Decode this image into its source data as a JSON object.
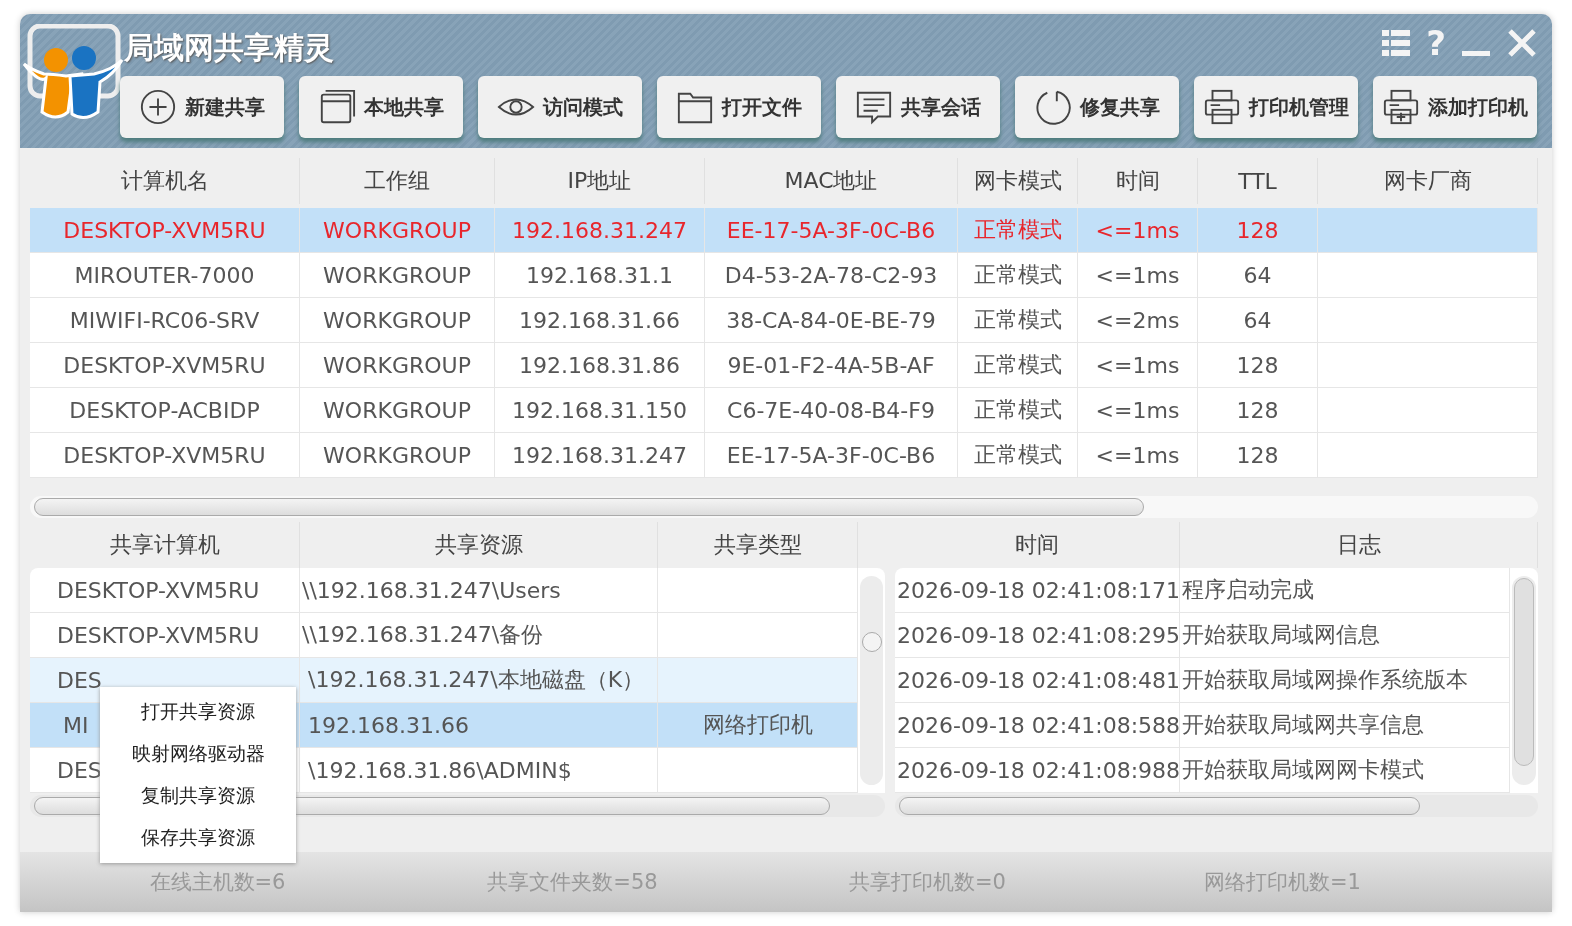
{
  "window": {
    "title": "局域网共享精灵",
    "controls": {
      "help": "?"
    }
  },
  "toolbar": [
    {
      "label": "新建共享",
      "kind": "plus"
    },
    {
      "label": "本地共享",
      "kind": "window"
    },
    {
      "label": "访问模式",
      "kind": "eye"
    },
    {
      "label": "打开文件",
      "kind": "folder"
    },
    {
      "label": "共享会话",
      "kind": "chat"
    },
    {
      "label": "修复共享",
      "kind": "refresh"
    },
    {
      "label": "打印机管理",
      "kind": "printer"
    },
    {
      "label": "添加打印机",
      "kind": "printer-add"
    }
  ],
  "hosts": {
    "columns": [
      "计算机名",
      "工作组",
      "IP地址",
      "MAC地址",
      "网卡模式",
      "时间",
      "TTL",
      "网卡厂商"
    ],
    "rows": [
      {
        "cells": [
          "DESKTOP-XVM5RU",
          "WORKGROUP",
          "192.168.31.247",
          "EE-17-5A-3F-0C-B6",
          "正常模式",
          "<=1ms",
          "128"
        ],
        "selected": true
      },
      {
        "cells": [
          "MIROUTER-7000",
          "WORKGROUP",
          "192.168.31.1",
          "D4-53-2A-78-C2-93",
          "正常模式",
          "<=1ms",
          "64"
        ],
        "selected": false
      },
      {
        "cells": [
          "MIWIFI-RC06-SRV",
          "WORKGROUP",
          "192.168.31.66",
          "38-CA-84-0E-BE-79",
          "正常模式",
          "<=2ms",
          "64"
        ],
        "selected": false
      },
      {
        "cells": [
          "DESKTOP-XVM5RU",
          "WORKGROUP",
          "192.168.31.86",
          "9E-01-F2-4A-5B-AF",
          "正常模式",
          "<=1ms",
          "128"
        ],
        "selected": false
      },
      {
        "cells": [
          "DESKTOP-ACBIDP",
          "WORKGROUP",
          "192.168.31.150",
          "C6-7E-40-08-B4-F9",
          "正常模式",
          "<=1ms",
          "128"
        ],
        "selected": false
      },
      {
        "cells": [
          "DESKTOP-XVM5RU",
          "WORKGROUP",
          "192.168.31.247",
          "EE-17-5A-3F-0C-B6",
          "正常模式",
          "<=1ms",
          "128"
        ],
        "selected": false
      }
    ]
  },
  "shares": {
    "columns": [
      "共享计算机",
      "共享资源",
      "共享类型"
    ],
    "rows": [
      {
        "cells": [
          "DESKTOP-XVM5RU",
          "\\\\192.168.31.247\\Users",
          ""
        ],
        "selected": false,
        "hovered": false
      },
      {
        "cells": [
          "DESKTOP-XVM5RU",
          "\\\\192.168.31.247\\备份",
          ""
        ],
        "selected": false,
        "hovered": false
      },
      {
        "cells": [
          "DES",
          "\\192.168.31.247\\本地磁盘（K）",
          ""
        ],
        "selected": false,
        "hovered": true
      },
      {
        "cells": [
          "MI",
          "192.168.31.66",
          "网络打印机"
        ],
        "selected": true,
        "hovered": false
      },
      {
        "cells": [
          "DES",
          "\\192.168.31.86\\ADMIN$",
          ""
        ],
        "selected": false,
        "hovered": false
      }
    ]
  },
  "context_menu": [
    "打开共享资源",
    "映射网络驱动器",
    "复制共享资源",
    "保存共享资源"
  ],
  "log": {
    "columns": [
      "时间",
      "日志"
    ],
    "rows": [
      [
        "2026-09-18 02:41:08:171",
        "程序启动完成"
      ],
      [
        "2026-09-18 02:41:08:295",
        "开始获取局域网信息"
      ],
      [
        "2026-09-18 02:41:08:481",
        "开始获取局域网操作系统版本"
      ],
      [
        "2026-09-18 02:41:08:588",
        "开始获取局域网共享信息"
      ],
      [
        "2026-09-18 02:41:08:988",
        "开始获取局域网网卡模式"
      ]
    ]
  },
  "status_bar": [
    "在线主机数=6",
    "共享文件夹数=58",
    "共享打印机数=0",
    "网络打印机数=1"
  ]
}
